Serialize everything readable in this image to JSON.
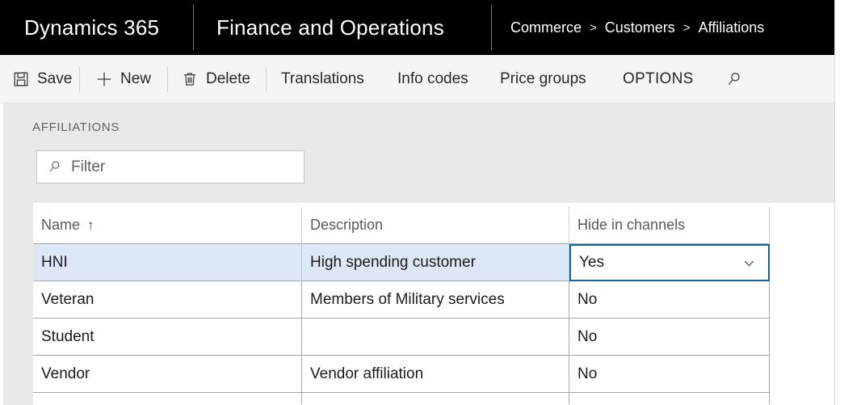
{
  "topbar": {
    "product": "Dynamics 365",
    "module": "Finance and Operations",
    "breadcrumb": [
      "Commerce",
      "Customers",
      "Affiliations"
    ],
    "separator": ">"
  },
  "toolbar": {
    "save_label": "Save",
    "new_label": "New",
    "delete_label": "Delete",
    "translations_label": "Translations",
    "info_codes_label": "Info codes",
    "price_groups_label": "Price groups",
    "options_label": "OPTIONS",
    "save_icon": "save-floppy-icon",
    "new_icon": "plus-icon",
    "delete_icon": "trash-icon",
    "search_icon": "search-icon"
  },
  "content": {
    "page_title": "AFFILIATIONS",
    "filter": {
      "value": "",
      "placeholder": "Filter",
      "icon": "search-icon"
    }
  },
  "grid": {
    "columns": [
      {
        "label": "Name",
        "sorted": "ascending",
        "sort_glyph": "↑"
      },
      {
        "label": "Description",
        "sorted": "none",
        "sort_glyph": ""
      },
      {
        "label": "Hide in channels",
        "sorted": "none",
        "sort_glyph": ""
      }
    ],
    "rows": [
      {
        "name": "HNI",
        "description": "High spending customer",
        "hide_in_channels": "Yes",
        "selected": true,
        "focused_cell": "hide_in_channels"
      },
      {
        "name": "Veteran",
        "description": "Members of Military services",
        "hide_in_channels": "No",
        "selected": false,
        "focused_cell": ""
      },
      {
        "name": "Student",
        "description": "",
        "hide_in_channels": "No",
        "selected": false,
        "focused_cell": ""
      },
      {
        "name": "Vendor",
        "description": "Vendor affiliation",
        "hide_in_channels": "No",
        "selected": false,
        "focused_cell": ""
      }
    ],
    "dropdown_icon": "chevron-down-icon"
  },
  "colors": {
    "topbar_bg": "#000000",
    "toolbar_bg": "#f5f5f5",
    "panel_bg": "#e9e9e9",
    "row_selected_bg": "#dde8f6",
    "focus_border": "#16659e",
    "grid_line": "#a6a6a6"
  }
}
